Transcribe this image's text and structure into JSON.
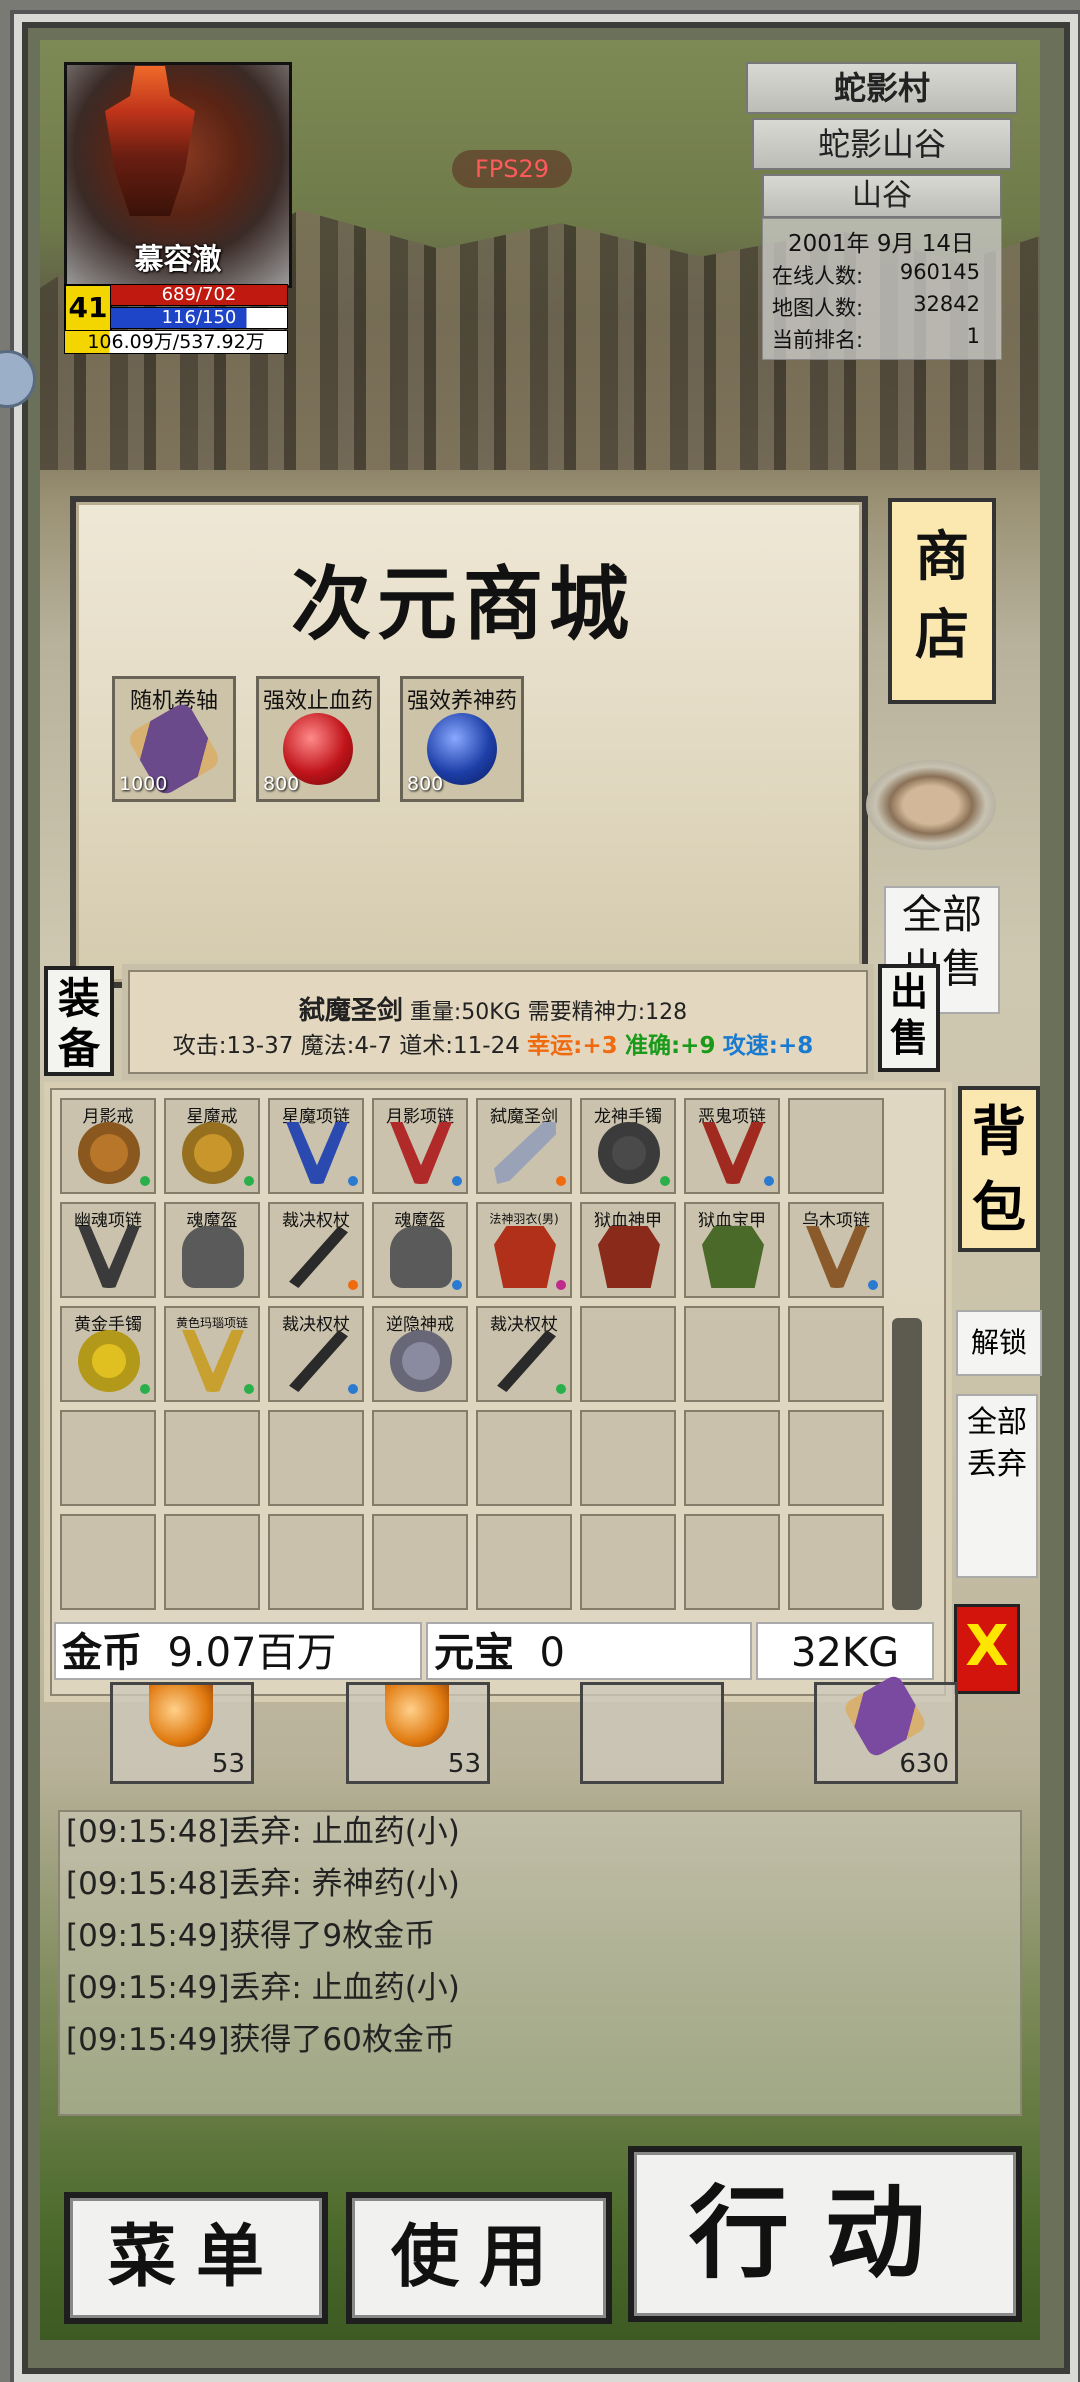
{
  "player": {
    "name": "慕容澈",
    "level": "41",
    "hp": "689/702",
    "mp": "116/150",
    "exp": "106.09万/537.92万"
  },
  "fps": "FPS29",
  "location": {
    "area": "蛇影村",
    "map": "蛇影山谷",
    "zone": "山谷",
    "date": "2001年 9月 14日",
    "stats": [
      {
        "label": "在线人数:",
        "value": "960145"
      },
      {
        "label": "地图人数:",
        "value": "32842"
      },
      {
        "label": "当前排名:",
        "value": "1"
      }
    ]
  },
  "shop": {
    "title": "次元商城",
    "tab_label": "商店",
    "items": [
      {
        "name": "随机卷轴",
        "price": "1000",
        "color": "#6a4a8a"
      },
      {
        "name": "强效止血药",
        "price": "800",
        "color": "#c0141a"
      },
      {
        "name": "强效养神药",
        "price": "800",
        "color": "#1d3fa8"
      }
    ],
    "sell_all": "全部出售"
  },
  "equip_tab": "装备",
  "sell_tab": "出售",
  "item_info": {
    "name": "弑魔圣剑",
    "attrs": "重量:50KG 需要精神力:128",
    "stats": "攻击:13-37 魔法:4-7 道术:11-24",
    "luck": "幸运:+3",
    "accuracy": "准确:+9",
    "speed": "攻速:+8",
    "colors": {
      "luck": "#f06a10",
      "accuracy": "#1a9a1a",
      "speed": "#1a7ad0"
    }
  },
  "bag": {
    "tab_label": "背包",
    "unlock": "解锁",
    "drop_all": "全部丢弃",
    "close": "X",
    "rows": [
      [
        {
          "name": "月影戒",
          "icon": "ring-icon",
          "color": "#b8762a",
          "dot": "#2ab04a"
        },
        {
          "name": "星魔戒",
          "icon": "ring-icon",
          "color": "#c8962a",
          "dot": "#2ab04a"
        },
        {
          "name": "星魔项链",
          "icon": "necklace-icon",
          "color": "#2a4ab0",
          "dot": "#2a7ad0"
        },
        {
          "name": "月影项链",
          "icon": "necklace-icon",
          "color": "#b02a2a",
          "dot": "#2a7ad0"
        },
        {
          "name": "弑魔圣剑",
          "icon": "sword-icon",
          "color": "#9aa2b8",
          "dot": "#f06a10"
        },
        {
          "name": "龙神手镯",
          "icon": "bracelet-icon",
          "color": "#4a4a4a",
          "dot": "#2ab04a"
        },
        {
          "name": "恶鬼项链",
          "icon": "necklace-icon",
          "color": "#a02a20",
          "dot": "#2a7ad0"
        },
        {
          "name": "",
          "icon": "",
          "color": "",
          "dot": ""
        }
      ],
      [
        {
          "name": "幽魂项链",
          "icon": "necklace-icon",
          "color": "#3a3a3a",
          "dot": ""
        },
        {
          "name": "魂魔盔",
          "icon": "helmet-icon",
          "color": "#5a5a5a",
          "dot": ""
        },
        {
          "name": "裁决权杖",
          "icon": "staff-icon",
          "color": "#2a2a2a",
          "dot": "#f06a10"
        },
        {
          "name": "魂魔盔",
          "icon": "helmet-icon",
          "color": "#5a5a5a",
          "dot": "#2a7ad0"
        },
        {
          "name": "法神羽衣(男)",
          "icon": "armor-icon",
          "color": "#b0301a",
          "dot": "#c02a8a"
        },
        {
          "name": "狱血神甲",
          "icon": "armor-icon",
          "color": "#8a2a1a",
          "dot": ""
        },
        {
          "name": "狱血宝甲",
          "icon": "armor-icon",
          "color": "#4a6a2a",
          "dot": ""
        },
        {
          "name": "乌木项链",
          "icon": "necklace-icon",
          "color": "#8a5a2a",
          "dot": "#2a7ad0"
        }
      ],
      [
        {
          "name": "黄金手镯",
          "icon": "bracelet-icon",
          "color": "#e0c020",
          "dot": "#2ab04a"
        },
        {
          "name": "黄色玛瑙项链",
          "icon": "necklace-icon",
          "color": "#c8a030",
          "dot": "#2ab04a"
        },
        {
          "name": "裁决权杖",
          "icon": "staff-icon",
          "color": "#2a2a2a",
          "dot": "#2a7ad0"
        },
        {
          "name": "逆隐神戒",
          "icon": "ring-icon",
          "color": "#8a8aa0",
          "dot": ""
        },
        {
          "name": "裁决权杖",
          "icon": "staff-icon",
          "color": "#2a2a2a",
          "dot": "#2ab04a"
        },
        {
          "name": "",
          "icon": "",
          "color": "",
          "dot": ""
        },
        {
          "name": "",
          "icon": "",
          "color": "",
          "dot": ""
        },
        {
          "name": "",
          "icon": "",
          "color": "",
          "dot": ""
        }
      ]
    ],
    "empty_rows": 2,
    "gold_label": "金币",
    "gold_value": "9.07百万",
    "yuanbao_label": "元宝",
    "yuanbao_value": "0",
    "weight": "32KG"
  },
  "quickbar": [
    {
      "count": "53",
      "icon": "potion-icon"
    },
    {
      "count": "53",
      "icon": "potion-icon"
    },
    {
      "count": "",
      "icon": ""
    },
    {
      "count": "630",
      "icon": "scroll-icon"
    }
  ],
  "log": [
    "[09:15:48]丢弃: 止血药(小)",
    "[09:15:48]丢弃: 养神药(小)",
    "[09:15:49]获得了9枚金币",
    "[09:15:49]丢弃: 止血药(小)",
    "[09:15:49]获得了60枚金币"
  ],
  "buttons": {
    "menu": "菜单",
    "use": "使用",
    "action": "行动"
  }
}
